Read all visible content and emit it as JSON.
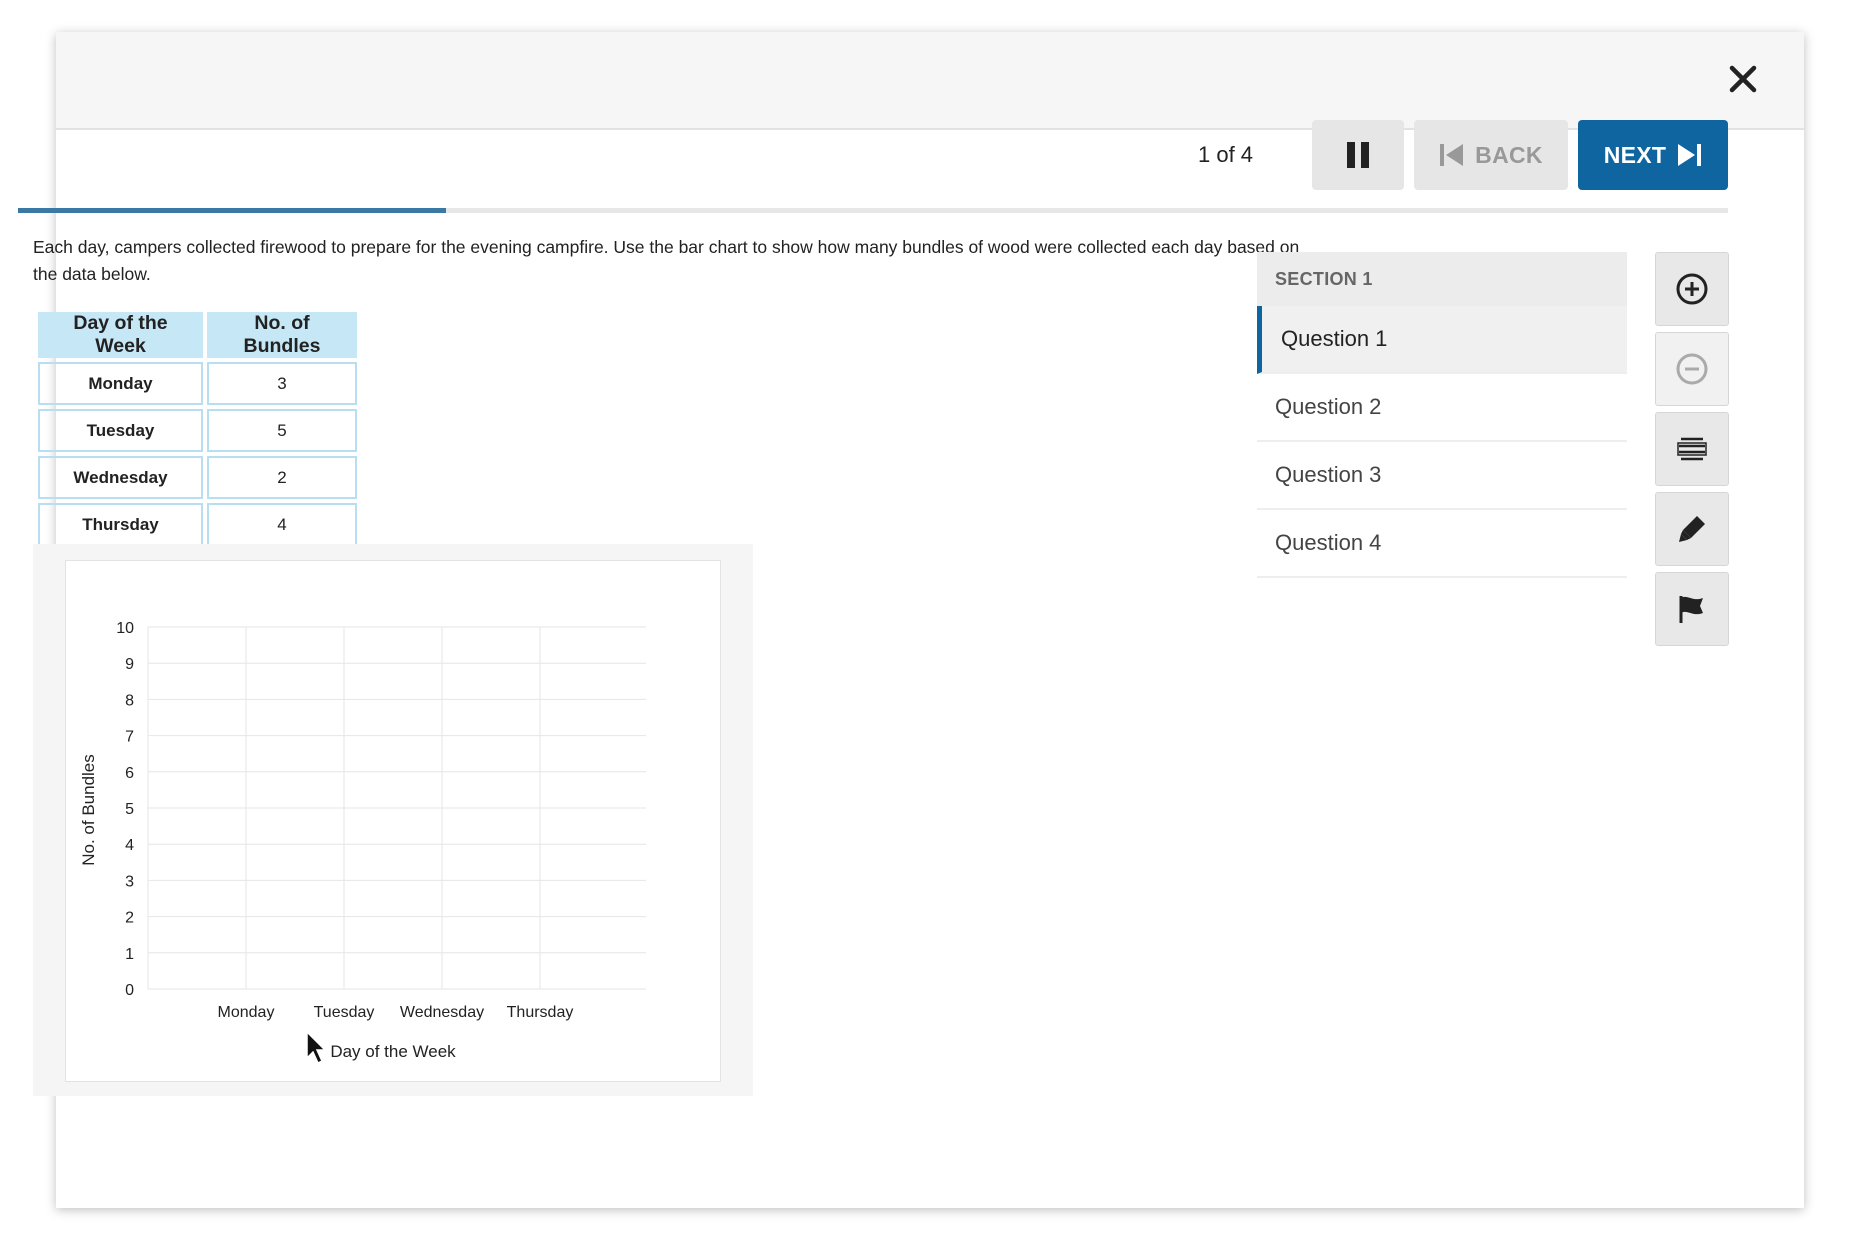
{
  "header": {
    "counter": "1 of 4",
    "back_label": "BACK",
    "next_label": "NEXT",
    "progress_fraction": 0.25
  },
  "prompt": "Each day, campers collected firewood to prepare for the evening campfire. Use the bar chart to show how many bundles of wood were collected each day based on the data below.",
  "table": {
    "headers": [
      "Day of the Week",
      "No. of Bundles"
    ],
    "rows": [
      {
        "day": "Monday",
        "bundles": "3"
      },
      {
        "day": "Tuesday",
        "bundles": "5"
      },
      {
        "day": "Wednesday",
        "bundles": "2"
      },
      {
        "day": "Thursday",
        "bundles": "4"
      }
    ]
  },
  "chart_data": {
    "type": "bar",
    "categories": [
      "Monday",
      "Tuesday",
      "Wednesday",
      "Thursday"
    ],
    "values": [
      0,
      0,
      0,
      0
    ],
    "xlabel": "Day of the Week",
    "ylabel": "No. of Bundles",
    "ylim": [
      0,
      10
    ],
    "yticks": [
      "0",
      "1",
      "2",
      "3",
      "4",
      "5",
      "6",
      "7",
      "8",
      "9",
      "10"
    ],
    "grid": true
  },
  "sidebar": {
    "section_label": "SECTION 1",
    "questions": [
      "Question 1",
      "Question 2",
      "Question 3",
      "Question 4"
    ]
  },
  "tools": [
    "zoom-in-icon",
    "zoom-out-icon",
    "line-reader-icon",
    "highlighter-icon",
    "flag-icon"
  ],
  "colors": {
    "accent": "#0f65a0",
    "table_header": "#c6e7f6",
    "table_border": "#b8def2"
  }
}
